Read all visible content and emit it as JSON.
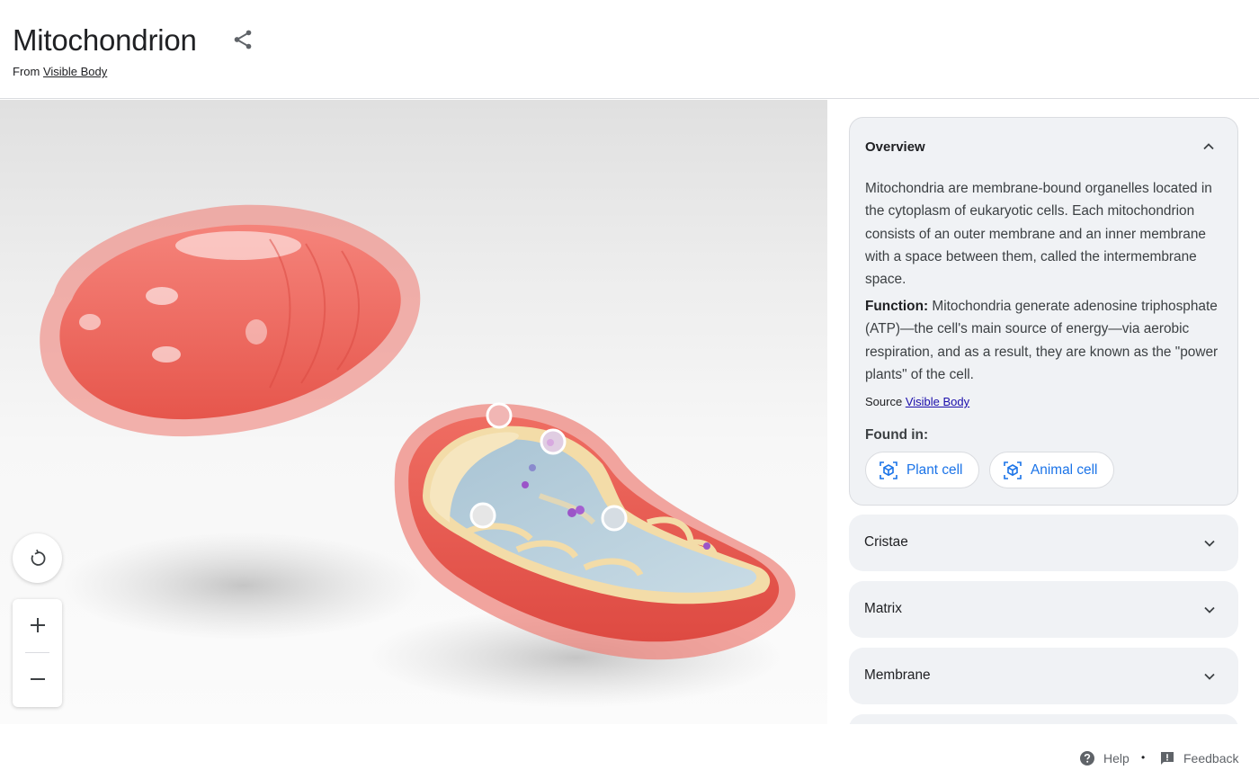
{
  "header": {
    "title": "Mitochondrion",
    "source_prefix": "From",
    "source_link": "Visible Body"
  },
  "viewer": {
    "model": "mitochondrion-3d-model",
    "reset_icon": "rotate-reset-icon",
    "zoom_in_icon": "plus-icon",
    "zoom_out_icon": "minus-icon"
  },
  "overview": {
    "heading": "Overview",
    "description": "Mitochondria are membrane-bound organelles located in the cytoplasm of eukaryotic cells. Each mitochondrion consists of an outer membrane and an inner membrane with a space between them, called the intermembrane space.",
    "function_label": "Function:",
    "function_text": " Mitochondria generate adenosine triphosphate (ATP)—the cell's main source of energy—via aerobic respiration, and as a result, they are known as the \"power plants\" of the cell.",
    "source_prefix": "Source",
    "source_link": "Visible Body",
    "found_in_label": "Found in:",
    "found_in": [
      "Plant cell",
      "Animal cell"
    ]
  },
  "sections": [
    "Cristae",
    "Matrix",
    "Membrane",
    ""
  ],
  "footer": {
    "help": "Help",
    "separator": "•",
    "feedback": "Feedback"
  },
  "colors": {
    "link_blue": "#1a73e8",
    "card_bg": "#f0f2f5",
    "membrane_red": "#e8534a",
    "inner_cream": "#f5e3b3",
    "matrix_blue": "#b5cedb"
  }
}
